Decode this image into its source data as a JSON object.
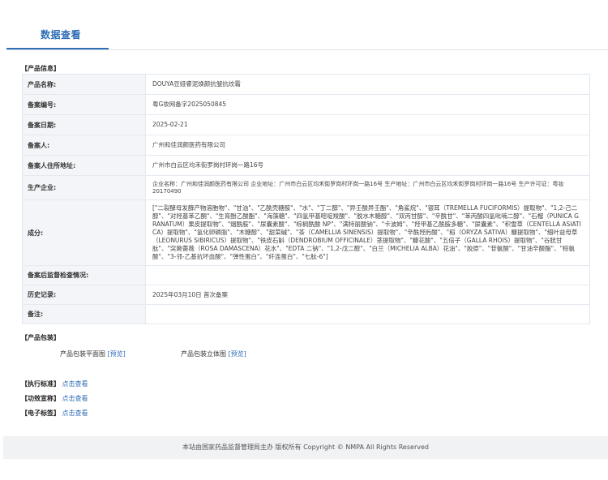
{
  "tab": {
    "active_label": "数据查看"
  },
  "product_info": {
    "section_title": "【产品信息】",
    "rows": [
      {
        "label": "产品名称:",
        "value": "DOUYA豆娅睿泥焕颜抗皱抗纹霜"
      },
      {
        "label": "备案编号:",
        "value": "粤G妆网备字2025050845"
      },
      {
        "label": "备案日期:",
        "value": "2025-02-21"
      },
      {
        "label": "备案人:",
        "value": "广州和佳润颜医药有限公司"
      },
      {
        "label": "备案人住所地址:",
        "value": "广州市白云区均禾街罗岗村环岗一路16号"
      },
      {
        "label": "生产企业:",
        "value": "企业名称：广州和佳润颜医药有限公司 企业地址：广州市白云区均禾街罗岗村环岗一路16号 生产地址：广州市白云区均禾街罗岗村环岗一路16号 生产许可证：粤妆20170490"
      },
      {
        "label": "成分:",
        "value": "[\"二裂酵母发酵产物溶胞物\"、\"甘油\"、\"乙酰壳糖胺\"、\"水\"、\"丁二醇\"、\"异壬酸异壬酯\"、\"角鲨烷\"、\"银耳（TREMELLA FUCIFORMIS）提取物\"、\"1,2-己二醇\"、\"对羟基苯乙酮\"、\"生育酚乙酸酯\"、\"海藻糖\"、\"四氢甲基嘧啶羧酸\"、\"脱水木糖醇\"、\"双丙甘醇\"、\"辛酰甘\"、\"苯丙酸四氢吡喃二醇\"、\"石榴（PUNICA GRANATUM）果皮提取物\"、\"烟酰胺\"、\"尿囊素酸\"、\"棕榈酰酸 NP\"、\"满特丽酸钠\"、\"卡波姆\"、\"羟甲基乙酰胺多糖\"、\"尿囊素\"、\"积雪草（CENTELLA ASIATICA）提取物\"、\"氢化卵磷脂\"、\"木糖醇\"、\"甜菜碱\"、\"茶（CAMELLIA SINENSIS）提取物\"、\"辛酰羟肟酸\"、\"稻（ORYZA SATIVA）糠提取物\"、\"细叶益母草（LEONURUS SIBIRICUS）提取物\"、\"铁皮石斛（DENDROBIUM OFFICINALE）茎提取物\"、\"糠花酸\"、\"五倍子（GALLA RHOIS）提取物\"、\"谷胱甘肽\"、\"突厥蔷薇（ROSA DAMASCENA）花水\"、\"EDTA 二钠\"、\"1,2-戊二醇\"、\"白兰（MICHELIA ALBA）花油\"、\"胶原\"、\"苷氨酸\"、\"甘油辛酸酯\"、\"棕氨酸\"、\"3-邻-乙基抗坏血酸\"、\"弹性蛋白\"、\"纤连蛋白\"、\"七肽-6\"]"
      },
      {
        "label": "备案后监督检查情况:",
        "value": ""
      },
      {
        "label": "历史记录:",
        "value": "2025年03月10日 首次备案"
      },
      {
        "label": "备注:",
        "value": ""
      }
    ]
  },
  "packaging": {
    "section_title": "【产品包装】",
    "flat_label": "产品包装平面图",
    "flat_link": "[预览]",
    "solid_label": "产品包装立体图",
    "solid_link": "[预览]"
  },
  "standards": [
    {
      "key": "【执行标准】",
      "link": "点击查看"
    },
    {
      "key": "【功效宣称】",
      "link": "点击查看"
    },
    {
      "key": "【电子标签】",
      "link": "点击查看"
    }
  ],
  "footer": {
    "text": "本站由国家药品监督管理局主办 版权所有 Copyright © NMPA All Rights Reserved"
  },
  "colors": {
    "accent": "#2f6db5",
    "label_bg": "#f3f5f8",
    "footer_bg": "#f1f2f4"
  }
}
